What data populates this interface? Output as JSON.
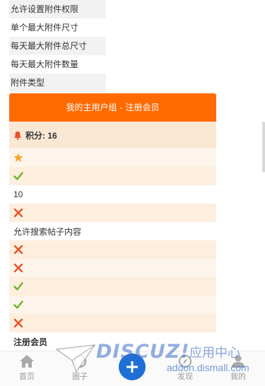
{
  "top_list": [
    "允许设置附件权限",
    "单个最大附件尺寸",
    "每天最大附件总尺寸",
    "每天最大附件数量",
    "附件类型"
  ],
  "card": {
    "header_prefix": "我的主用户组",
    "header_sep": "-",
    "header_group": "注册会员",
    "points_label": "积分: 16",
    "rows": [
      {
        "kind": "icon",
        "icon": "star-icon"
      },
      {
        "kind": "icon",
        "icon": "check-icon"
      },
      {
        "kind": "text",
        "text": "10"
      },
      {
        "kind": "icon",
        "icon": "cross-icon"
      },
      {
        "kind": "text",
        "text": "允许搜索帖子内容"
      },
      {
        "kind": "icon",
        "icon": "cross-icon"
      },
      {
        "kind": "icon",
        "icon": "cross-icon"
      },
      {
        "kind": "icon",
        "icon": "check-icon"
      },
      {
        "kind": "icon",
        "icon": "check-icon"
      },
      {
        "kind": "icon",
        "icon": "cross-icon"
      },
      {
        "kind": "text",
        "text": "注册会员",
        "bold": true
      }
    ]
  },
  "tabbar": {
    "home": "首页",
    "circle": "圈子",
    "discover": "发现",
    "mine": "我的"
  },
  "watermark": {
    "logo": "DISCUZ!",
    "cn": "应用中心",
    "url": "addon.dismall.com"
  },
  "colors": {
    "header": "#ff6a00",
    "check": "#6ab42a",
    "cross": "#e8502a",
    "star": "#f5a623",
    "plus": "#1e6fd6"
  }
}
